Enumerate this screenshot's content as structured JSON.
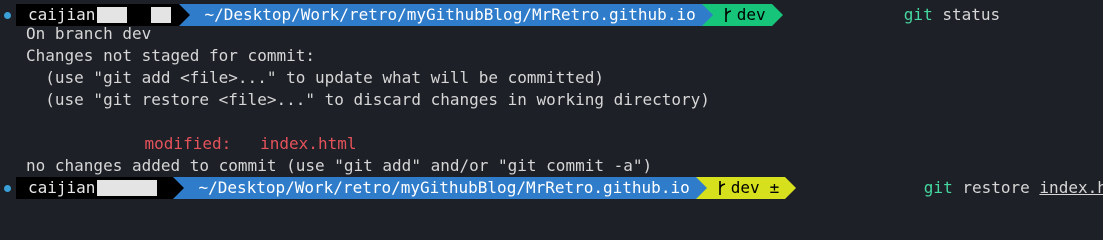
{
  "prompt1": {
    "user": "caijian",
    "path": "~/Desktop/Work/retro/myGithubBlog/MrRetro.github.io",
    "branch": "dev",
    "command": "git",
    "command_args": "status"
  },
  "output": {
    "line1": "On branch dev",
    "line2": "Changes not staged for commit:",
    "line3": "  (use \"git add <file>...\" to update what will be committed)",
    "line4": "  (use \"git restore <file>...\" to discard changes in working directory)",
    "modified_label": "modified:",
    "modified_file": "index.html",
    "line7": "no changes added to commit (use \"git add\" and/or \"git commit -a\")"
  },
  "prompt2": {
    "user": "caijian",
    "path": "~/Desktop/Work/retro/myGithubBlog/MrRetro.github.io",
    "branch": "dev",
    "dirty_marker": "±",
    "command": "git",
    "command_verb": "restore",
    "command_file": "index.html"
  },
  "colors": {
    "background": "#1e2028",
    "user_segment": "#000000",
    "path_segment": "#2f7ccb",
    "branch_clean": "#17c57a",
    "branch_dirty": "#d7e01c",
    "command": "#45d8a0",
    "modified": "#e4525a",
    "prompt_dot": "#3aa0d8"
  },
  "icons": {
    "branch": "git-branch-icon",
    "prompt_marker": "prompt-dot-icon",
    "segment_separator": "powerline-arrow-icon"
  }
}
